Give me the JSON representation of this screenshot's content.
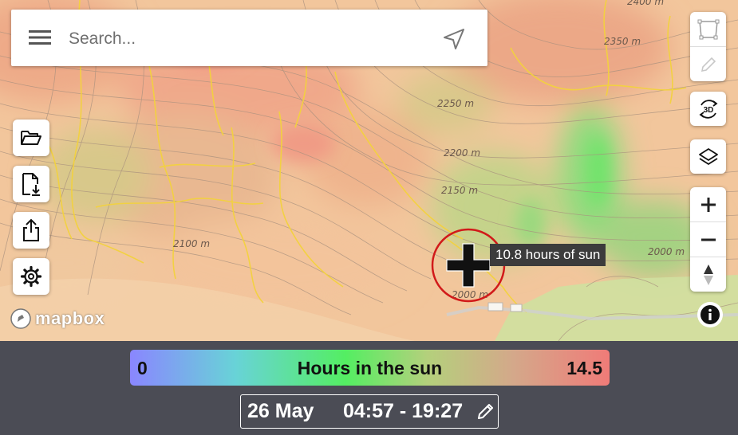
{
  "search": {
    "placeholder": "Search..."
  },
  "icons": {
    "menu": "hamburger-menu-icon",
    "locate": "navigation-arrow-icon",
    "open": "folder-open-icon",
    "download": "file-download-icon",
    "share": "share-upload-icon",
    "settings": "gear-icon",
    "draw_polygon": "polygon-select-icon",
    "edit": "pencil-icon",
    "view3d": "rotate-3d-icon",
    "layers": "layers-icon",
    "zoom_in": "plus-icon",
    "zoom_out": "minus-icon",
    "compass": "compass-icon",
    "info": "info-icon"
  },
  "map": {
    "attribution": "mapbox",
    "contour_labels": [
      "2400 m",
      "2350 m",
      "2250 m",
      "2200 m",
      "2150 m",
      "2100 m",
      "2000 m",
      "2000 m"
    ],
    "view3d_label": "3D",
    "tooltip": "10.8 hours of sun"
  },
  "legend": {
    "min": "0",
    "title": "Hours in the sun",
    "max": "14.5",
    "colors": [
      "#8a86ff",
      "#68d3d7",
      "#54ee62",
      "#b4d07c",
      "#d4a88a",
      "#f07b78"
    ]
  },
  "date": {
    "day": "26 May",
    "time_range": "04:57 - 19:27"
  },
  "accent": {
    "marker_ring": "#d11a1a"
  }
}
